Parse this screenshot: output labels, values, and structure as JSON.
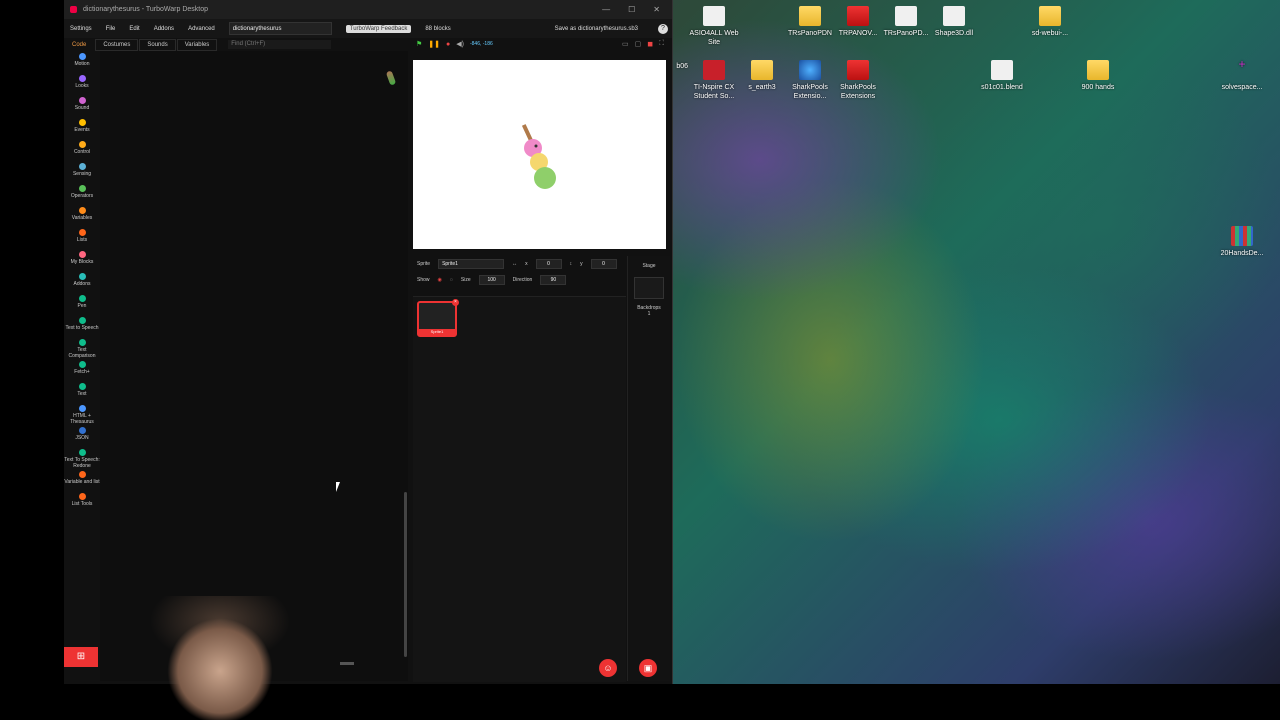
{
  "window": {
    "title": "dictionarythesurus - TurboWarp Desktop",
    "controls": [
      "—",
      "☐",
      "✕"
    ]
  },
  "menubar": {
    "settings": "Settings",
    "file": "File",
    "edit": "Edit",
    "addons": "Addons",
    "advanced": "Advanced",
    "project_title": "dictionarythesurus",
    "feedback": "TurboWarp Feedback",
    "blocks_count": "88 blocks",
    "save": "Save as dictionarythesurus.sb3",
    "help": "?"
  },
  "tabs": [
    "Code",
    "Costumes",
    "Sounds",
    "Variables"
  ],
  "find_placeholder": "Find (Ctrl+F)",
  "stage_coords": "-846, -186",
  "categories": [
    {
      "label": "Motion",
      "color": "#4c97ff"
    },
    {
      "label": "Looks",
      "color": "#9966ff"
    },
    {
      "label": "Sound",
      "color": "#cf63cf"
    },
    {
      "label": "Events",
      "color": "#ffbf00"
    },
    {
      "label": "Control",
      "color": "#ffab19"
    },
    {
      "label": "Sensing",
      "color": "#5cb1d6"
    },
    {
      "label": "Operators",
      "color": "#59c059"
    },
    {
      "label": "Variables",
      "color": "#ff8c1a"
    },
    {
      "label": "Lists",
      "color": "#ff661a"
    },
    {
      "label": "My Blocks",
      "color": "#ff6680"
    },
    {
      "label": "Addons",
      "color": "#29beb8"
    },
    {
      "label": "Pen",
      "color": "#0fbd8c"
    },
    {
      "label": "Text to Speech",
      "color": "#0fbd8c"
    },
    {
      "label": "Text Comparison",
      "color": "#0fbd8c"
    },
    {
      "label": "Fetch+",
      "color": "#0fbd8c"
    },
    {
      "label": "Text",
      "color": "#0fbd8c"
    },
    {
      "label": "HTML + Thesaurus",
      "color": "#4c97ff"
    },
    {
      "label": "JSON",
      "color": "#3271d0"
    },
    {
      "label": "Text To Speech: Redone",
      "color": "#0fbd8c"
    },
    {
      "label": "Variable and list",
      "color": "#ff661a"
    },
    {
      "label": "List Tools",
      "color": "#ff661a"
    }
  ],
  "sprite_info": {
    "sprite_label": "Sprite",
    "sprite_name": "Sprite1",
    "x_label": "x",
    "x_value": "0",
    "y_label": "y",
    "y_value": "0",
    "show_label": "Show",
    "size_label": "Size",
    "size_value": "100",
    "direction_label": "Direction",
    "direction_value": "90"
  },
  "sprite_list": [
    {
      "name": "Sprite1"
    }
  ],
  "stage_panel": {
    "label": "Stage",
    "backdrops_label": "Backdrops",
    "backdrops_count": "1"
  },
  "desktop_icons": [
    {
      "label": "ASIO4ALL Web Site",
      "kind": "doc"
    },
    {
      "label": "TRsPanoPDN",
      "kind": "folder"
    },
    {
      "label": "TRPANOV...",
      "kind": "pkg"
    },
    {
      "label": "TRsPanoPD...",
      "kind": "doc"
    },
    {
      "label": "Shape3D.dll",
      "kind": "doc"
    },
    {
      "label": "sd-webui-...",
      "kind": "folder"
    },
    {
      "label": "b06",
      "kind": "folder"
    },
    {
      "label": "TI-Nspire CX Student So...",
      "kind": "redapp"
    },
    {
      "label": "s_earth3",
      "kind": "folder"
    },
    {
      "label": "SharkPools Extensio...",
      "kind": "globe"
    },
    {
      "label": "SharkPools Extensions",
      "kind": "pkg"
    },
    {
      "label": "s01c01.blend",
      "kind": "doc"
    },
    {
      "label": "900 hands",
      "kind": "folder"
    },
    {
      "label": "solvespace...",
      "kind": "doc"
    },
    {
      "label": "20HandsDe...",
      "kind": "chip"
    }
  ]
}
